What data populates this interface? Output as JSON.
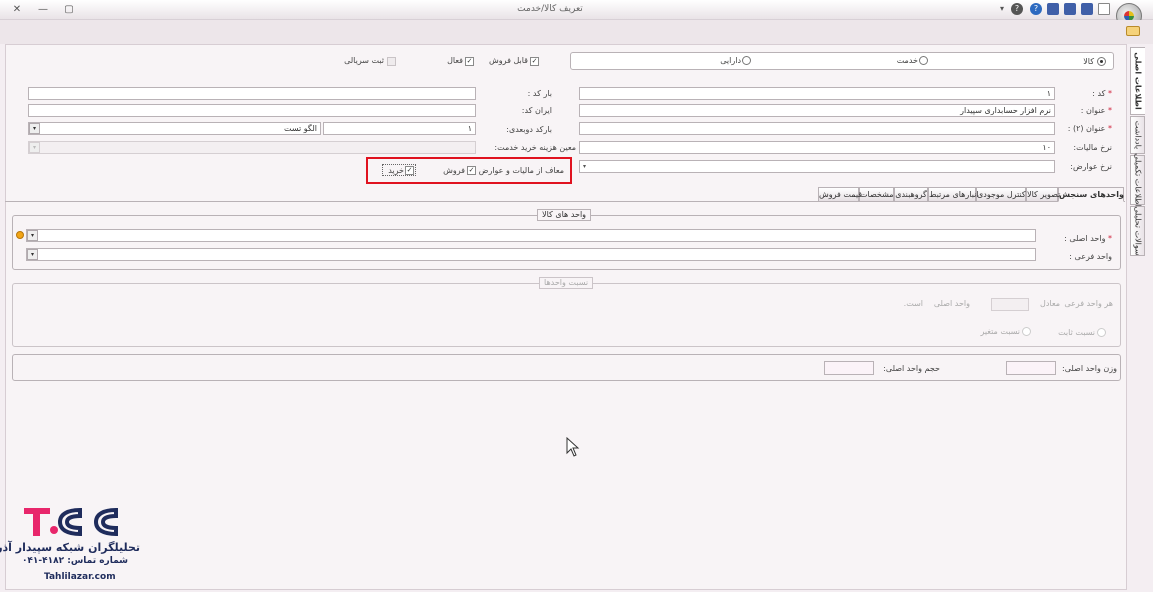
{
  "window": {
    "title": "تعریف کالا/خدمت",
    "close_glyph": "✕",
    "minimize_glyph": "—",
    "maximize_glyph": "▢"
  },
  "type_radio": {
    "options": [
      "کالا",
      "خدمت",
      "دارایی"
    ],
    "selected": "کالا"
  },
  "flags": {
    "sellable": "قابل فروش",
    "active": "فعال",
    "serial_reg": "ثبت سریالی"
  },
  "form": {
    "code_label": "کد :",
    "code_value": "۱",
    "title_label": "عنوان :",
    "title_value": "نرم افزار حسابداری سپیدار",
    "title2_label": "عنوان (۲) :",
    "tax_label": "نرخ مالیات:",
    "tax_value": "۱۰",
    "duty_label": "نرخ عوارض:",
    "barcode_label": "بار کد :",
    "irancode_label": "ایران کد:",
    "barcode2_label": "بارکد دوبعدی:",
    "barcode2_value": "۱",
    "barcode2_pattern": "الگو تست",
    "cost_label": "معین هزینه خرید خدمت:",
    "exempt_label": "معاف از مالیات و عوارض :",
    "exempt_sale": "فروش",
    "exempt_buy": "خرید"
  },
  "tabs": [
    "واحدهای سنجش",
    "تصویر کالا",
    "کنترل موجودی",
    "انبارهای مرتبط",
    "گروهبندی",
    "مشخصات",
    "قیمت فروش"
  ],
  "units": {
    "group_title": "واحد های کالا",
    "main_unit_label": "واحد اصلی :",
    "sub_unit_label": "واحد فرعی :"
  },
  "ratio": {
    "group_title": "نسبت واحدها",
    "each_sub": "هر واحد فرعی",
    "equals": "معادل",
    "main_unit": "واحد اصلی",
    "is": "است.",
    "fixed": "نسبت ثابت",
    "variable": "نسبت متغیر"
  },
  "weight": {
    "weight_label": "وزن واحد اصلی:",
    "volume_label": "حجم واحد اصلی:"
  },
  "side_tabs": [
    "اطلاعات اصلی",
    "یادداشت",
    "اطلاعات تکمیلی",
    "سوالات تحلیلی"
  ],
  "branding": {
    "logo_mark": "TSS",
    "company": "تحلیلگران شبکه سپیدار آذر",
    "phone": "شماره تماس: ۴۱۸۲-۰۴۱",
    "website": "Tahlilazar.com"
  },
  "colors": {
    "accent_red": "#e0121f",
    "logo_pink": "#e8266b",
    "logo_navy": "#1f2c5c"
  }
}
